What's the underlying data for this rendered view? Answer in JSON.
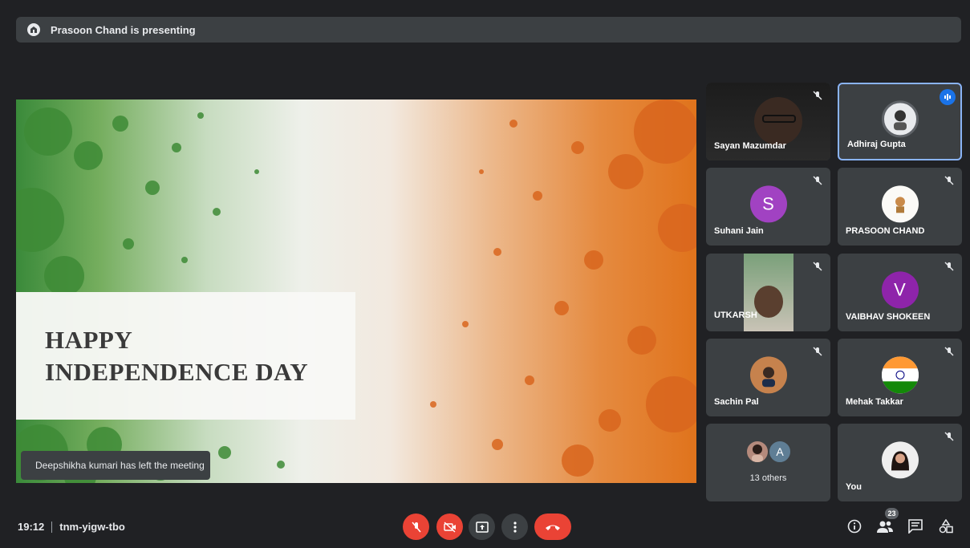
{
  "top_bar": {
    "presenting_text": "Prasoon Chand is presenting"
  },
  "slide": {
    "title_line_1": "HAPPY",
    "title_line_2": "INDEPENDENCE DAY"
  },
  "toast": {
    "text": "Deepshikha kumari has left the meeting"
  },
  "participants": [
    {
      "name": "Sayan Mazumdar",
      "type": "video",
      "muted": true
    },
    {
      "name": "Adhiraj Gupta",
      "type": "photo",
      "speaking": true
    },
    {
      "name": "Suhani Jain",
      "type": "initial",
      "initial": "S",
      "color": "#a142c2",
      "muted": true
    },
    {
      "name": "PRASOON CHAND",
      "type": "photo",
      "muted": true
    },
    {
      "name": "UTKARSH",
      "type": "video",
      "muted": true
    },
    {
      "name": "VAIBHAV SHOKEEN",
      "type": "initial",
      "initial": "V",
      "color": "#8e24aa",
      "muted": true
    },
    {
      "name": "Sachin Pal",
      "type": "photo",
      "muted": true
    },
    {
      "name": "Mehak Takkar",
      "type": "photo",
      "muted": true
    },
    {
      "name": "You",
      "type": "photo",
      "muted": true
    }
  ],
  "others": {
    "label": "13 others",
    "initial": "A"
  },
  "bottom_bar": {
    "time": "19:12",
    "meeting_code": "tnm-yigw-tbo",
    "people_count": "23"
  },
  "colors": {
    "background": "#202124",
    "tile": "#3c4043",
    "danger": "#ea4335",
    "accent": "#1a73e8"
  },
  "icons": [
    "presenter-icon",
    "mic-off-icon",
    "camera-off-icon",
    "present-icon",
    "more-options-icon",
    "hang-up-icon",
    "info-icon",
    "people-icon",
    "chat-icon",
    "activities-icon",
    "speaking-icon"
  ]
}
